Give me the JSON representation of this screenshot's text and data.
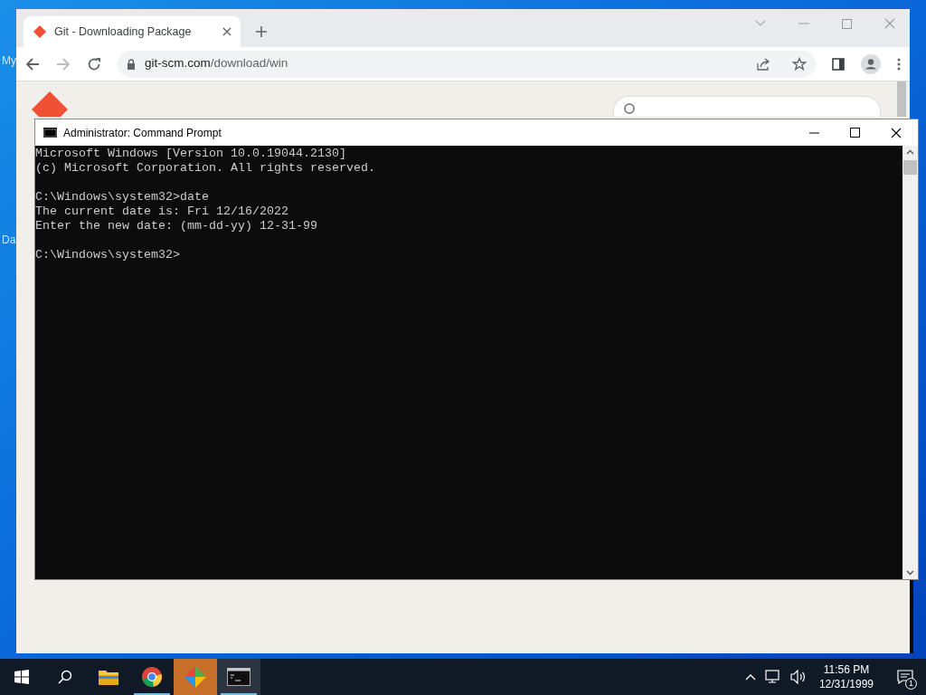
{
  "desktop": {
    "icon_labels": [
      "My",
      "Da"
    ]
  },
  "browser": {
    "tabs": [
      {
        "title": "Git - Downloading Package",
        "selected": true
      }
    ],
    "url_host": "git-scm.com",
    "url_path": "/download/win"
  },
  "console": {
    "title": "Administrator: Command Prompt",
    "blocks": [
      [
        "Microsoft Windows [Version 10.0.19044.2130]",
        "(c) Microsoft Corporation. All rights reserved."
      ],
      [
        "C:\\Windows\\system32>date",
        "The current date is: Fri 12/16/2022",
        "Enter the new date: (mm-dd-yy) 12-31-99"
      ],
      [
        "C:\\Windows\\system32>"
      ]
    ]
  },
  "taskbar": {
    "apps": [
      {
        "kind": "explorer",
        "running": false,
        "selected": false
      },
      {
        "kind": "chrome",
        "running": true,
        "selected": false
      },
      {
        "kind": "git",
        "running": false,
        "selected": true
      },
      {
        "kind": "console",
        "running": true,
        "selected": false
      }
    ],
    "time": "11:56 PM",
    "date": "12/31/1999",
    "notifications": "1"
  }
}
